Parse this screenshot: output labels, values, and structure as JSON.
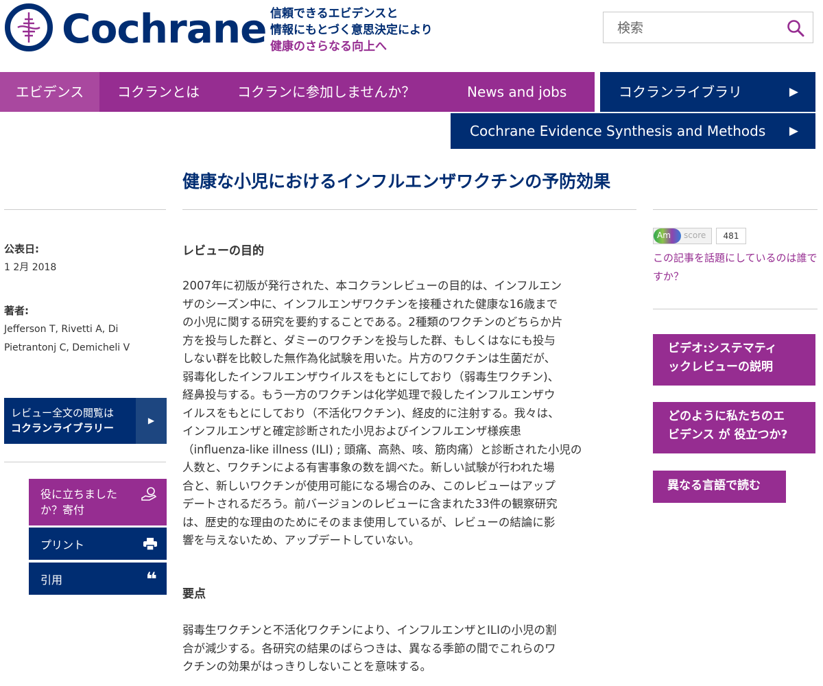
{
  "header": {
    "logo_text": "Cochrane",
    "tagline": [
      "信頼できるエビデンスと",
      "情報にもとづく意思決定により",
      "健康のさらなる向上へ"
    ],
    "search_placeholder": "検索"
  },
  "nav": {
    "items": [
      {
        "label": "エビデンス",
        "active": true
      },
      {
        "label": "コクランとは"
      },
      {
        "label": "コクランに参加しませんか？"
      },
      {
        "label": "News and jobs"
      }
    ],
    "library_label": "コクランライブラリ",
    "methods_label": "Cochrane Evidence Synthesis and Methods",
    "arrow": "▶"
  },
  "page_title": "健康な小児におけるインフルエンザワクチンの予防効果",
  "left": {
    "published_label": "公表日:",
    "published_value": "1 2月 2018",
    "authors_label": "著者:",
    "authors_value": "Jefferson T, Rivetti A, Di Pietrantonj C, Demicheli V",
    "review_btn_line1": "レビュー全文の閲覧は",
    "review_btn_line2": "コクランライブラリー",
    "review_btn_arrow": "▶",
    "donate_label": "役に立ちました か？寄付",
    "print_label": "プリント",
    "cite_label": "引用",
    "cite_icon": "❝"
  },
  "main": {
    "section1_title": "レビューの目的",
    "section1_body": "2007年に初版が発行された、本コクランレビューの目的は、インフルエン\nザのシーズン中に、インフルエンザワクチンを接種された健康な16歳まで\nの小児に関する研究を要約することである。2種類のワクチンのどちらか片\n方を投与した群と、ダミーのワクチンを投与した群、もしくはなにも投与\nしない群を比較した無作為化試験を用いた。片方のワクチンは生菌だが、\n弱毒化したインフルエンザウイルスをもとにしており（弱毒生ワクチン)、\n経鼻投与する。もう一方のワクチンは化学処理で殺したインフルエンザウ\nイルスをもとにしており（不活化ワクチン)、経皮的に注射する。我々は、\nインフルエンザと確定診断された小児およびインフルエンザ様疾患\n（influenza-like illness (ILI) ; 頭痛、高熱、咳、筋肉痛）と診断された小児の\n人数と、ワクチンによる有害事象の数を調べた。新しい試験が行われた場\n合と、新しいワクチンが使用可能になる場合のみ、このレビューはアップ\nデートされるだろう。前バージョンのレビューに含まれた33件の観察研究\nは、歴史的な理由のためにそのまま使用しているが、レビューの結論に影\n響を与えないため、アップデートしていない。",
    "section2_title": "要点",
    "section2_body": "弱毒生ワクチンと不活化ワクチンにより、インフルエンザとILIの小児の割\n合が減少する。各研究の結果のばらつきは、異なる季節の間でこれらのワ\nクチンの効果がはっきりしないことを意味する。"
  },
  "right": {
    "altmetric_badge": "Am",
    "altmetric_score_label": "score",
    "altmetric_score": "481",
    "altmetric_link": "この記事を話題にしているのは誰ですか？",
    "video_btn": "ビデオ:システマティ\nックレビューの説明",
    "help_btn": "どのように私たちのエ\nビデンス が 役立つか?",
    "language_btn": "異なる言語で読む"
  },
  "colors": {
    "navy": "#002d72",
    "purple": "#962d91"
  }
}
